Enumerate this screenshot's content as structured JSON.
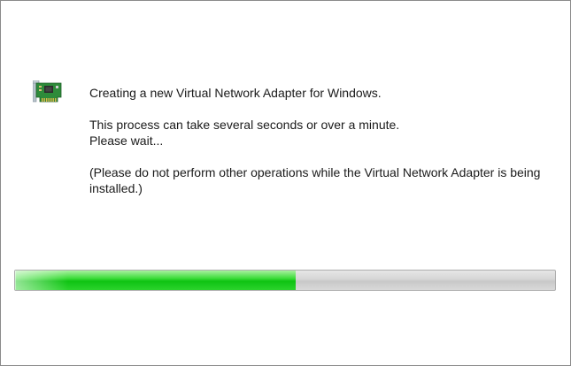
{
  "message": {
    "line1": "Creating a new Virtual Network Adapter for Windows.",
    "line2": "This process can take several seconds or over a minute.",
    "line3": "Please wait...",
    "line4": "(Please do not perform other operations while the Virtual Network Adapter is being installed.)"
  },
  "icon": {
    "name": "network-adapter-card-icon",
    "board_color": "#2e8b3a",
    "bracket_color": "#b8c4cc"
  },
  "progress": {
    "fraction": 0.52,
    "fill_color": "#1ccc1e",
    "track_color": "#d6d6d6"
  }
}
